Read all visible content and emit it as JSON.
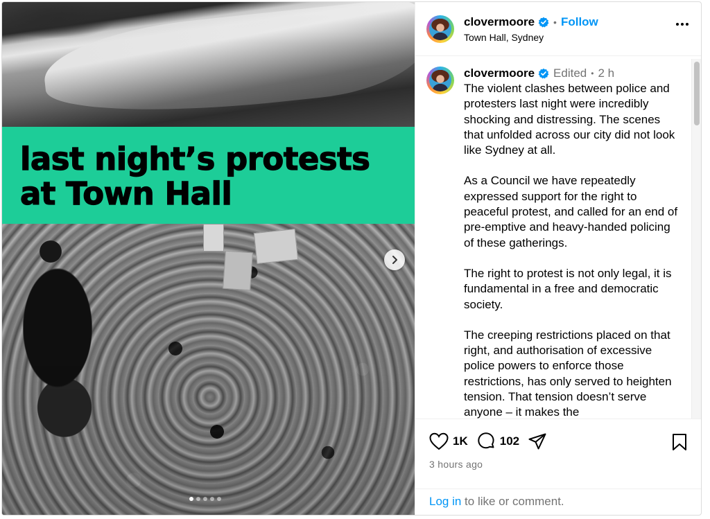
{
  "media": {
    "banner_line1": "last night’s protests",
    "banner_line2": "at Town Hall",
    "banner_color": "#1dcd98",
    "slide_count": 5,
    "active_slide": 1,
    "next_icon": "chevron-right-icon"
  },
  "header": {
    "username": "clovermoore",
    "separator": "•",
    "follow_label": "Follow",
    "location": "Town Hall, Sydney",
    "more_icon": "more-horizontal-icon"
  },
  "caption": {
    "username": "clovermoore",
    "edited_label": "Edited",
    "separator": "•",
    "time": "2 h",
    "paragraphs": [
      "The violent clashes between police and protesters last night were incredibly shocking and distressing. The scenes that unfolded across our city did not look like Sydney at all.",
      "As a Council we have repeatedly expressed support for the right to peaceful protest, and called for an end of pre-emptive and heavy-handed policing of these gatherings.",
      "The right to protest is not only legal, it is fundamental in a free and democratic society.",
      "The creeping restrictions placed on that right, and authorisation of excessive police powers to enforce those restrictions, has only served to heighten tension. That tension doesn’t serve anyone – it makes the"
    ]
  },
  "actions": {
    "likes": "1K",
    "comments": "102",
    "posted_ago": "3 hours ago",
    "login_link": "Log in",
    "login_suffix": " to like or comment."
  },
  "colors": {
    "link": "#0095f6",
    "muted": "#737373",
    "verified": "#0095f6"
  }
}
